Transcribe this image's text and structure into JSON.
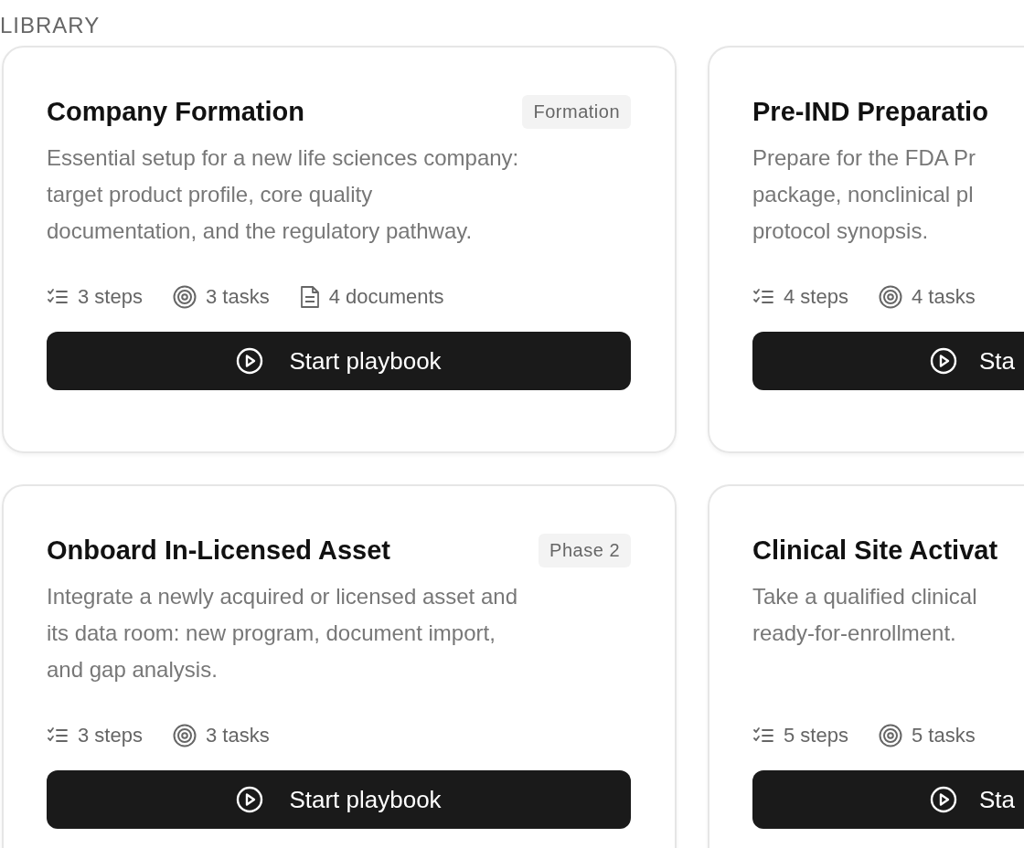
{
  "section_label": "LIBRARY",
  "cards": [
    {
      "title": "Company Formation",
      "tag": "Formation",
      "description_lines": [
        "Essential setup for a new life sciences company:",
        "target product profile, core quality",
        "documentation, and the regulatory pathway."
      ],
      "stats": [
        {
          "kind": "steps",
          "label": "3 steps"
        },
        {
          "kind": "tasks",
          "label": "3 tasks"
        },
        {
          "kind": "documents",
          "label": "4 documents"
        }
      ],
      "button": "Start playbook"
    },
    {
      "title": "Pre-IND Preparatio",
      "description_lines": [
        "Prepare for the FDA Pr",
        "package, nonclinical pl",
        "protocol synopsis."
      ],
      "stats": [
        {
          "kind": "steps",
          "label": "4 steps"
        },
        {
          "kind": "tasks",
          "label": "4 tasks"
        }
      ],
      "button": "Sta"
    },
    {
      "title": "Onboard In-Licensed Asset",
      "tag": "Phase 2",
      "description_lines": [
        "Integrate a newly acquired or licensed asset and",
        "its data room: new program, document import,",
        "and gap analysis."
      ],
      "stats": [
        {
          "kind": "steps",
          "label": "3 steps"
        },
        {
          "kind": "tasks",
          "label": "3 tasks"
        }
      ],
      "button": "Start playbook"
    },
    {
      "title": "Clinical Site Activat",
      "description_lines": [
        "Take a qualified clinical",
        "ready-for-enrollment."
      ],
      "stats": [
        {
          "kind": "steps",
          "label": "5 steps"
        },
        {
          "kind": "tasks",
          "label": "5 tasks"
        }
      ],
      "button": "Sta"
    }
  ]
}
